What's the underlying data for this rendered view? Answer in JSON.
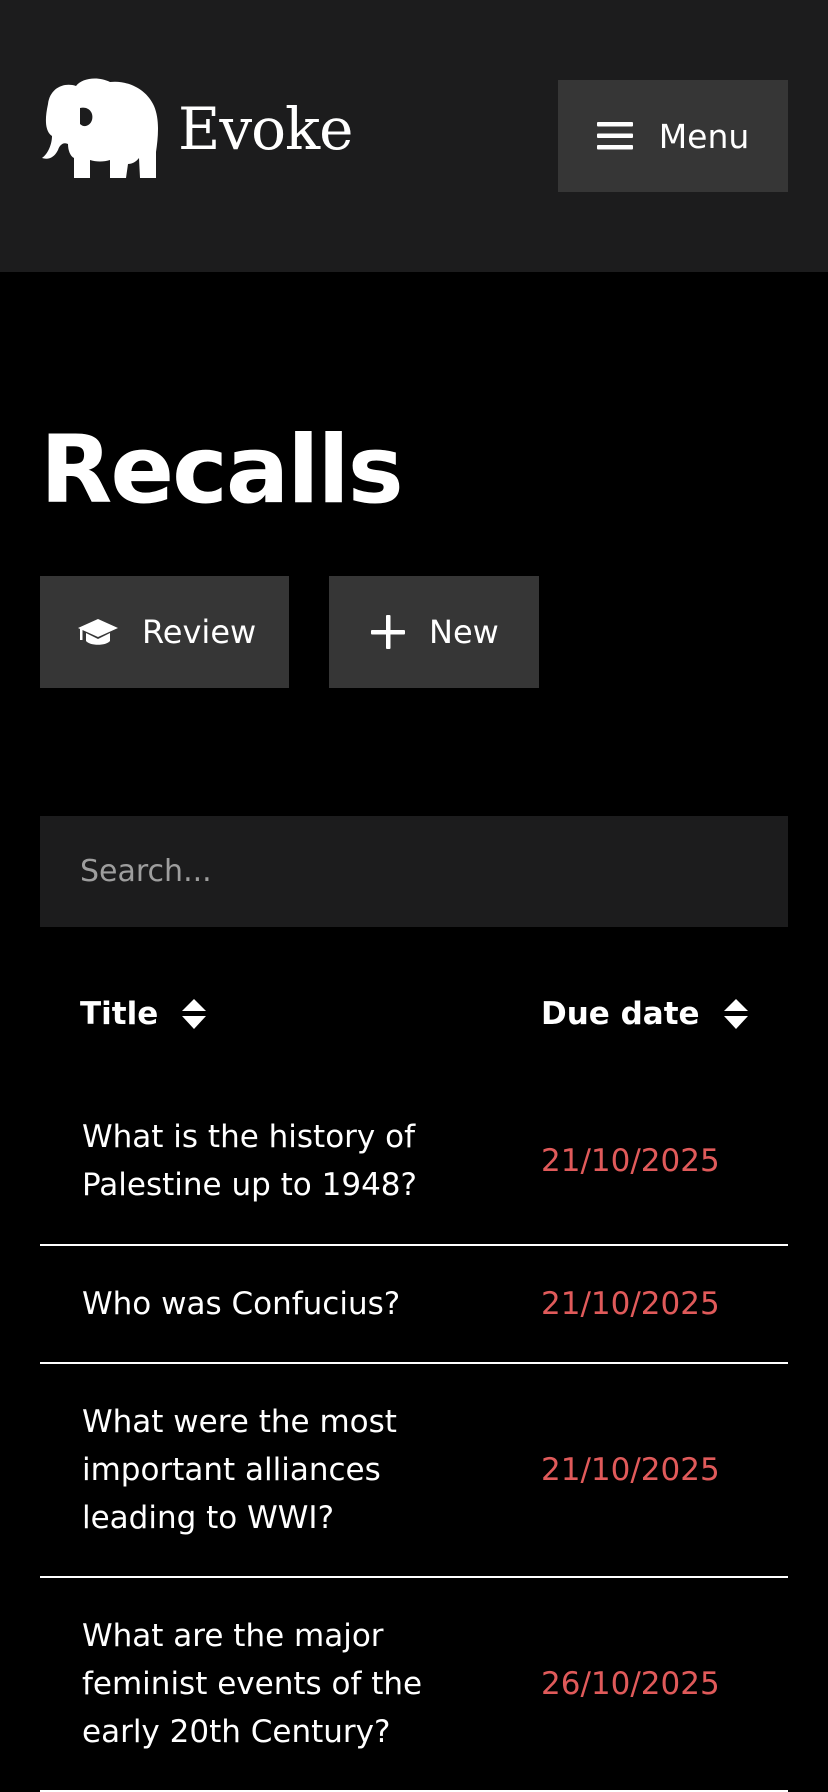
{
  "brand": {
    "name": "Evoke"
  },
  "header": {
    "menu_label": "Menu"
  },
  "page": {
    "title": "Recalls"
  },
  "actions": {
    "review_label": "Review",
    "new_label": "New"
  },
  "search": {
    "placeholder": "Search...",
    "value": ""
  },
  "table": {
    "columns": [
      "Title",
      "Due date"
    ],
    "rows": [
      {
        "title": "What is the history of Palestine up to 1948?",
        "due": "21/10/2025"
      },
      {
        "title": "Who was Confucius?",
        "due": "21/10/2025"
      },
      {
        "title": "What were the most important alliances leading to WWI?",
        "due": "21/10/2025"
      },
      {
        "title": "What are the major feminist events of the early 20th Century?",
        "due": "26/10/2025"
      }
    ]
  },
  "icons": {
    "logo": "elephant-icon",
    "menu": "hamburger-icon",
    "review": "graduation-cap-icon",
    "new": "plus-icon",
    "sort": "sort-icon"
  },
  "colors": {
    "header_bg": "#1c1c1d",
    "button_bg": "#363636",
    "page_bg": "#000000",
    "due_date": "#e05a5a",
    "text": "#ffffff"
  }
}
